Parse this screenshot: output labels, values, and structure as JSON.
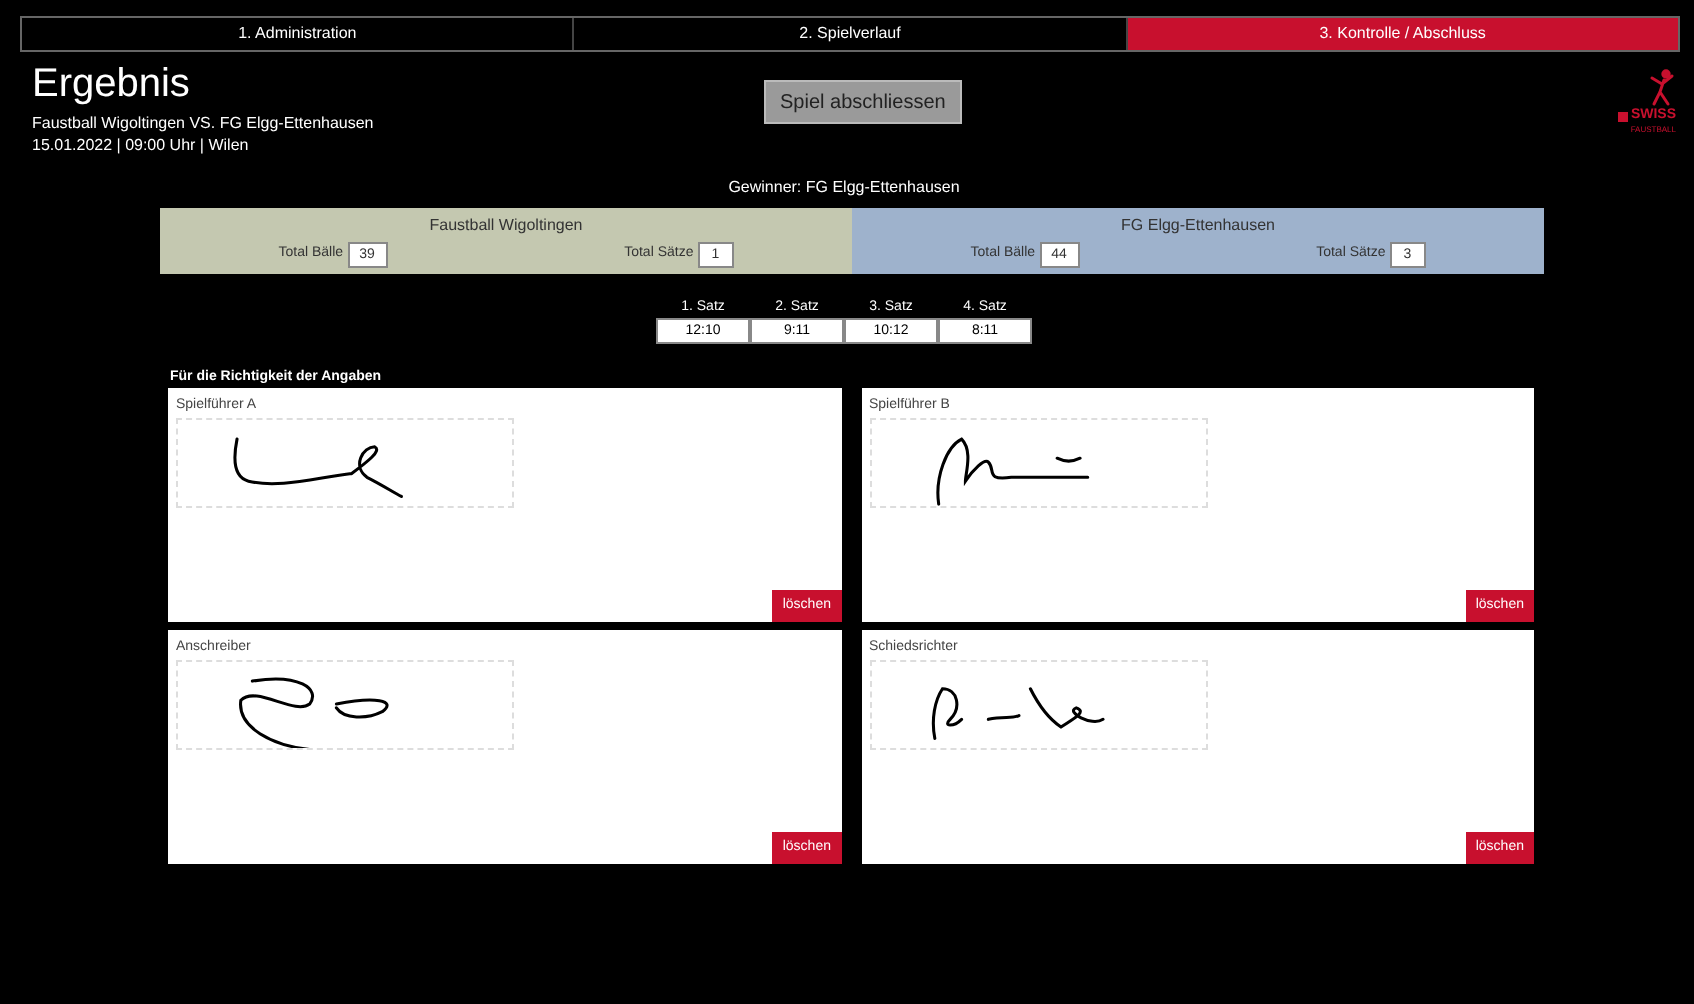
{
  "tabs": [
    {
      "label": "1. Administration",
      "selected": false
    },
    {
      "label": "2. Spielverlauf",
      "selected": false
    },
    {
      "label": "3. Kontrolle / Abschluss",
      "selected": true
    }
  ],
  "title": "Ergebnis",
  "match": "Faustball Wigoltingen VS. FG Elgg-Ettenhausen",
  "details": "15.01.2022 | 09:00 Uhr | Wilen",
  "finish_button": "Spiel abschliessen",
  "logo": {
    "text": "SWISS",
    "subtext": "FAUSTBALL"
  },
  "winner": "Gewinner: FG Elgg-Ettenhausen",
  "teams": [
    {
      "name": "Faustball Wigoltingen",
      "color": "#c4c8b0",
      "balls_label": "Total Bälle",
      "balls": "39",
      "sets_label": "Total Sätze",
      "sets": "1"
    },
    {
      "name": "FG Elgg-Ettenhausen",
      "color": "#9eb2cc",
      "balls_label": "Total Bälle",
      "balls": "44",
      "sets_label": "Total Sätze",
      "sets": "3"
    }
  ],
  "sets": [
    {
      "label": "1. Satz",
      "score": "12:10"
    },
    {
      "label": "2. Satz",
      "score": "9:11"
    },
    {
      "label": "3. Satz",
      "score": "10:12"
    },
    {
      "label": "4. Satz",
      "score": "8:11"
    }
  ],
  "signatures_heading": "Für die Richtigkeit der Angaben",
  "signatures": [
    {
      "label": "Spielführer A",
      "button": "löschen"
    },
    {
      "label": "Spielführer B",
      "button": "löschen"
    },
    {
      "label": "Anschreiber",
      "button": "löschen"
    },
    {
      "label": "Schiedsrichter",
      "button": "löschen"
    }
  ]
}
